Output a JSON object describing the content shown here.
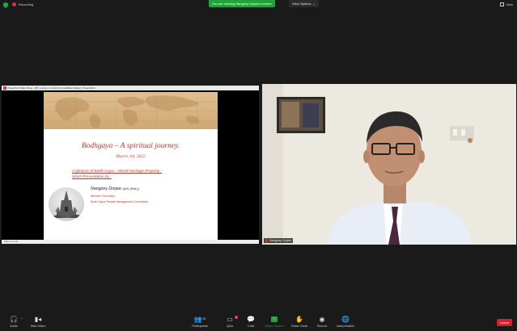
{
  "top": {
    "recording_label": "Recording",
    "viewing_banner": "You are viewing Nangzey Dorjee's screen",
    "view_options_label": "View Options",
    "view_button_label": "View"
  },
  "share": {
    "window_title": "PowerPoint Slide Show - [BT_Lecture (4-3-22) [Compatibility Mode]] - PowerPoint",
    "status_bar": "Slide 1 of 16"
  },
  "slide": {
    "title": "Bodhgaya – A spiritual journey.",
    "date": "March, 04, 2022",
    "glimpse_line1": "A glimpse of Bodh Gaya – World Heritage Property :",
    "glimpse_line2": "Short Presentation by :",
    "presenter_name": "Nangzey Dorjee",
    "presenter_suffix": "(IAS (Rtd.))",
    "role_line1": "Member Secretary,",
    "role_line2": "Bodh Gaya Temple Management Committee."
  },
  "camera": {
    "participant_name": "Nangzey Dorjee"
  },
  "toolbar": {
    "audio": "Audio",
    "start_video": "Start Video",
    "participants": "Participants",
    "participants_count": "81",
    "qa": "Q&A",
    "qa_badge": "1",
    "chat": "Chat",
    "share_screen": "Share Screen",
    "raise_hand": "Raise Hand",
    "record": "Record",
    "interpretation": "Interpretation",
    "leave": "Leave"
  },
  "colors": {
    "accent_green": "#22a33a",
    "leave_red": "#d4202c",
    "slide_red_text": "#c0392b"
  }
}
